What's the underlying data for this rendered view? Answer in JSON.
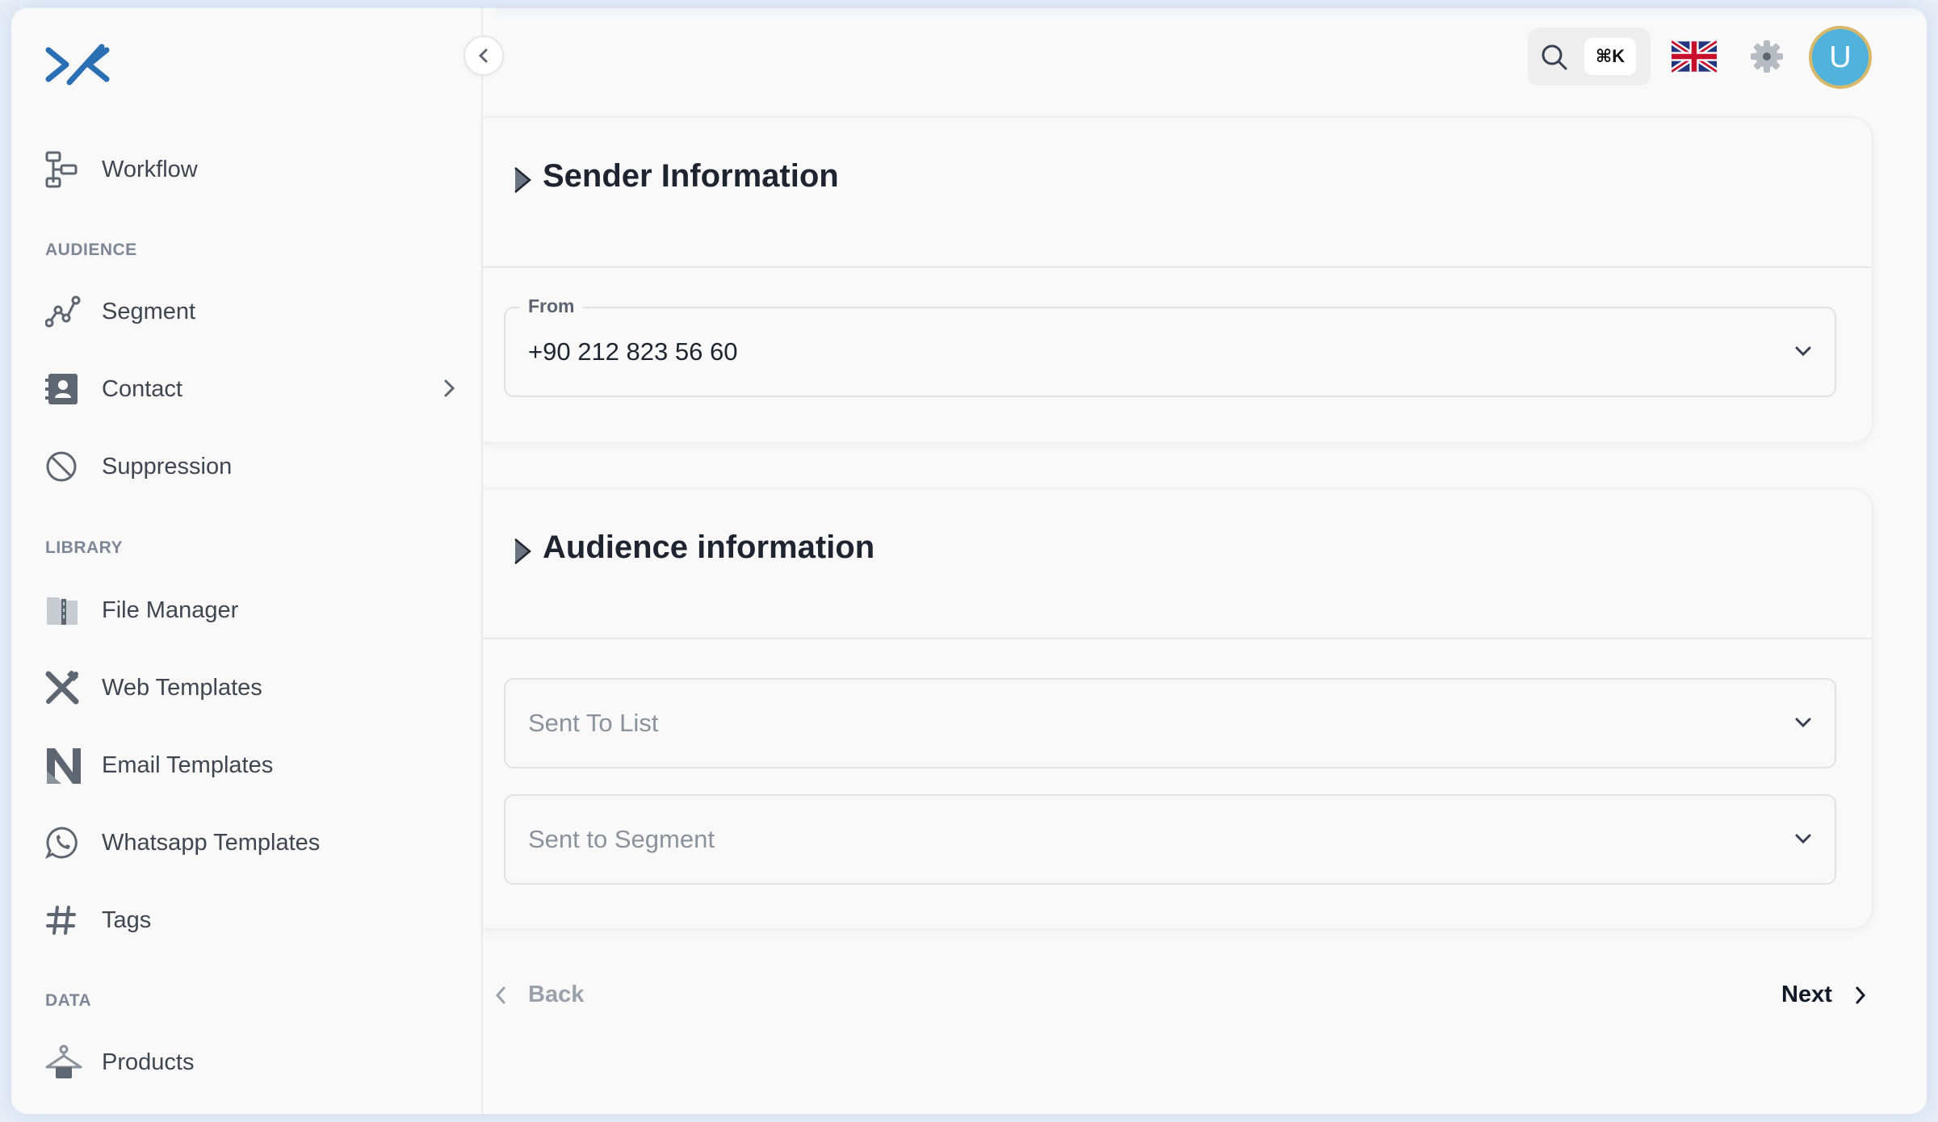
{
  "sidebar": {
    "collapse_icon": "chevron-left-icon",
    "items": {
      "workflow": {
        "label": "Workflow",
        "icon": "workflow-icon"
      },
      "segment": {
        "label": "Segment",
        "icon": "segment-icon"
      },
      "contact": {
        "label": "Contact",
        "icon": "contact-icon"
      },
      "suppression": {
        "label": "Suppression",
        "icon": "suppression-icon"
      },
      "file_manager": {
        "label": "File Manager",
        "icon": "folder-icon"
      },
      "web_templates": {
        "label": "Web Templates",
        "icon": "design-tools-icon"
      },
      "email_templates": {
        "label": "Email Templates",
        "icon": "email-template-icon"
      },
      "whatsapp_templates": {
        "label": "Whatsapp Templates",
        "icon": "whatsapp-icon"
      },
      "tags": {
        "label": "Tags",
        "icon": "hash-icon"
      },
      "products": {
        "label": "Products",
        "icon": "hanger-icon"
      }
    },
    "sections": {
      "audience": "AUDIENCE",
      "library": "LIBRARY",
      "data": "DATA"
    }
  },
  "header": {
    "shortcut": "⌘K",
    "avatar_initial": "U",
    "language": "English (UK)"
  },
  "sender": {
    "title": "Sender Information",
    "from_label": "From",
    "from_value": "+90 212 823 56 60"
  },
  "audience": {
    "title": "Audience information",
    "list_placeholder": "Sent To List",
    "segment_placeholder": "Sent to Segment"
  },
  "footer": {
    "back_label": "Back",
    "next_label": "Next"
  },
  "colors": {
    "brand": "#2a6fb4",
    "avatar": "#51b3dc",
    "accent_ring": "#d8b86a"
  }
}
